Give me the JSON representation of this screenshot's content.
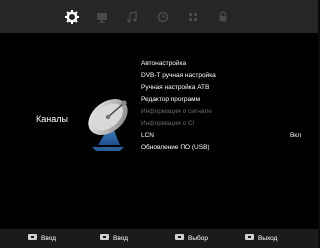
{
  "top_icons": [
    "gear-icon",
    "tv-icon",
    "music-icon",
    "clock-icon",
    "grid-icon",
    "lock-icon"
  ],
  "colors": {
    "top_bar": "#262626",
    "active_icon": "#ffffff",
    "inactive_icon": "#5a5a5a",
    "text": "#ffffff",
    "disabled_text": "#6a6a6a",
    "bottom_bar": "#1b1b1b"
  },
  "section": {
    "title": "Каналы",
    "icon": "satellite-dish-icon"
  },
  "menu": {
    "items": [
      {
        "label": "Автонастройка",
        "value": "",
        "enabled": true
      },
      {
        "label": "DVB-T  ручная настройка",
        "value": "",
        "enabled": true
      },
      {
        "label": "Ручная настройка АТВ",
        "value": "",
        "enabled": true
      },
      {
        "label": "Редактор программ",
        "value": "",
        "enabled": true
      },
      {
        "label": "Информация о сигнале",
        "value": "",
        "enabled": false
      },
      {
        "label": "Информация о CI",
        "value": "",
        "enabled": false
      },
      {
        "label": "LCN",
        "value": "Вкл",
        "enabled": true
      },
      {
        "label": "Обновление ПО (USB)",
        "value": "",
        "enabled": true
      }
    ]
  },
  "bottom_hints": [
    {
      "label": "Ввод",
      "icon": "key-icon"
    },
    {
      "label": "Ввод",
      "icon": "key-icon"
    },
    {
      "label": "Выбор",
      "icon": "key-icon"
    },
    {
      "label": "Выход",
      "icon": "key-icon"
    }
  ]
}
